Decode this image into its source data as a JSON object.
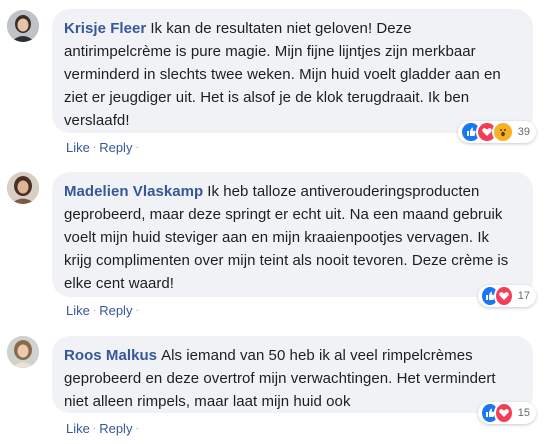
{
  "comments": [
    {
      "author": "Krisje Fleer",
      "text": "Ik kan de resultaten niet geloven! Deze antirimpelcrème is pure magie. Mijn fijne lijntjes zijn merkbaar verminderd in slechts twee weken. Mijn huid voelt gladder aan en ziet er jeugdiger uit. Het is alsof je de klok terugdraait. Ik ben verslaafd!",
      "reaction_count": "39",
      "reactions": [
        "like-icon",
        "love-icon",
        "wow-icon"
      ],
      "like_label": "Like",
      "reply_label": "Reply",
      "separator": "·"
    },
    {
      "author": "Madelien Vlaskamp",
      "text": "Ik heb talloze antiverouderingsproducten geprobeerd, maar deze springt er echt uit. Na een maand gebruik voelt mijn huid steviger aan en mijn kraaienpootjes vervagen. Ik krijg complimenten over mijn teint als nooit tevoren. Deze crème is elke cent waard!",
      "reaction_count": "17",
      "reactions": [
        "like-icon",
        "love-icon"
      ],
      "like_label": "Like",
      "reply_label": "Reply",
      "separator": "·"
    },
    {
      "author": "Roos Malkus",
      "text": "Als iemand van 50 heb ik al veel rimpelcrèmes geprobeerd en deze overtrof mijn verwachtingen. Het vermindert niet alleen rimpels, maar laat mijn huid ook",
      "reaction_count": "15",
      "reactions": [
        "like-icon",
        "love-icon"
      ],
      "like_label": "Like",
      "reply_label": "Reply",
      "separator": "·"
    }
  ],
  "colors": {
    "author": "#365899",
    "bubble": "#f0f2f5",
    "link": "#385898",
    "like": "#1877f2",
    "love": "#f33e58",
    "wow": "#f7b125"
  }
}
